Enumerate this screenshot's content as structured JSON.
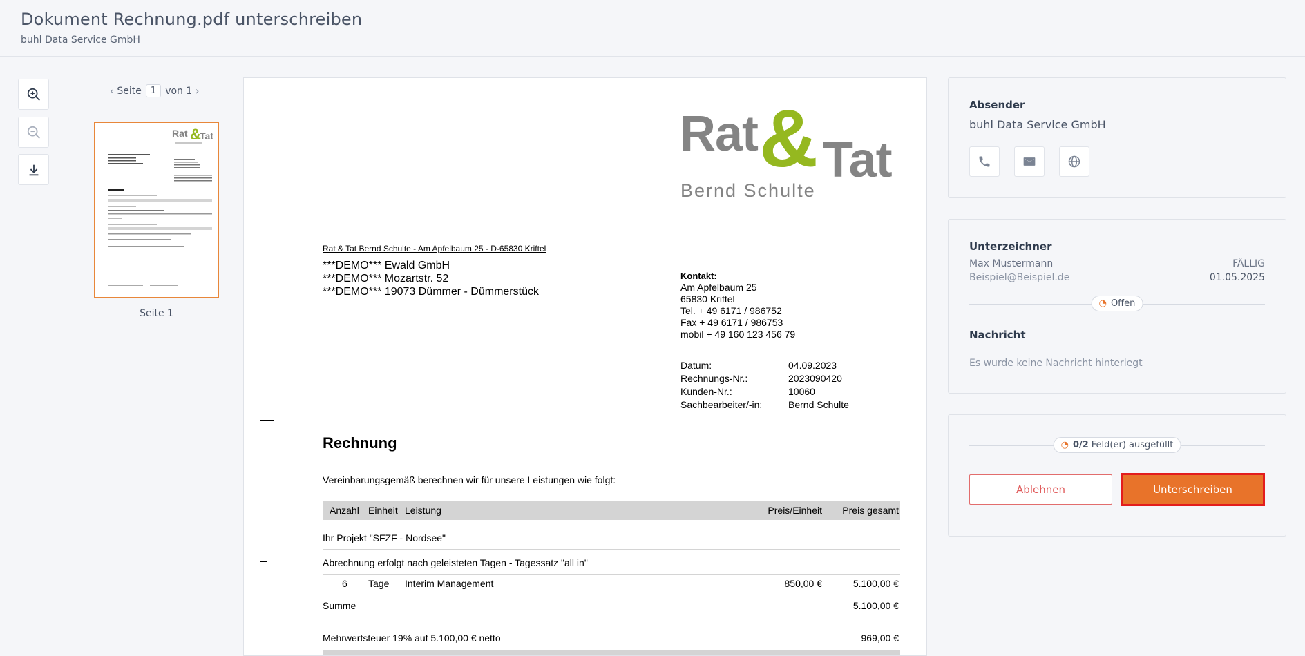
{
  "header": {
    "title": "Dokument Rechnung.pdf unterschreiben",
    "subtitle": "buhl Data Service GmbH"
  },
  "toolbar": {
    "zoom_in_icon": "zoom-in-icon",
    "zoom_out_icon": "zoom-out-icon",
    "download_icon": "download-icon"
  },
  "pager": {
    "prefix": "Seite",
    "current": "1",
    "suffix": "von 1",
    "thumb_label": "Seite 1"
  },
  "document": {
    "logo": {
      "rat": "Rat",
      "amp": "&",
      "tat": "Tat",
      "name": "Bernd Schulte"
    },
    "sender_line": "Rat & Tat Bernd Schulte - Am Apfelbaum 25 - D-65830 Kriftel",
    "recipient": [
      "***DEMO*** Ewald GmbH",
      "***DEMO*** Mozartstr. 52",
      "***DEMO*** 19073 Dümmer - Dümmerstück"
    ],
    "contact": {
      "label": "Kontakt:",
      "lines": [
        "Am Apfelbaum 25",
        "65830 Kriftel",
        "Tel. + 49 6171 / 986752",
        "Fax + 49 6171 / 986753",
        "mobil + 49 160 123 456 79"
      ]
    },
    "meta": [
      {
        "key": "Datum:",
        "value": "04.09.2023"
      },
      {
        "key": "Rechnungs-Nr.:",
        "value": "2023090420"
      },
      {
        "key": "Kunden-Nr.:",
        "value": "10060"
      },
      {
        "key": "Sachbearbeiter/-in:",
        "value": "Bernd Schulte"
      }
    ],
    "title": "Rechnung",
    "intro": "Vereinbarungsgemäß berechnen wir für unsere Leistungen wie folgt:",
    "table_headers": {
      "anzahl": "Anzahl",
      "einheit": "Einheit",
      "leistung": "Leistung",
      "preis_einheit": "Preis/Einheit",
      "preis_gesamt": "Preis gesamt"
    },
    "project_line": "Ihr Projekt \"SFZF - Nordsee\"",
    "billing_line": "Abrechnung erfolgt nach geleisteten Tagen - Tagessatz \"all in\"",
    "item": {
      "anzahl": "6",
      "einheit": "Tage",
      "leistung": "Interim Management",
      "preis_einheit": "850,00 €",
      "preis_gesamt": "5.100,00 €"
    },
    "summe_label": "Summe",
    "summe_value": "5.100,00 €",
    "mwst_label": "Mehrwertsteuer 19% auf 5.100,00 € netto",
    "mwst_value": "969,00 €"
  },
  "sender_card": {
    "heading": "Absender",
    "name": "buhl Data Service GmbH"
  },
  "signer_card": {
    "heading": "Unterzeichner",
    "name": "Max Mustermann",
    "due_label": "FÄLLIG",
    "email": "Beispiel@Beispiel.de",
    "due_date": "01.05.2025",
    "status": "Offen",
    "message_heading": "Nachricht",
    "message_text": "Es wurde keine Nachricht hinterlegt"
  },
  "action_card": {
    "progress_count": "0/2",
    "progress_text": "Feld(er) ausgefüllt",
    "reject_label": "Ablehnen",
    "sign_label": "Unterschreiben"
  },
  "colors": {
    "accent": "#e8732a",
    "reject": "#e05a5a",
    "highlight_border": "#e31d1d",
    "logo_green": "#95b820",
    "logo_gray": "#848484"
  }
}
